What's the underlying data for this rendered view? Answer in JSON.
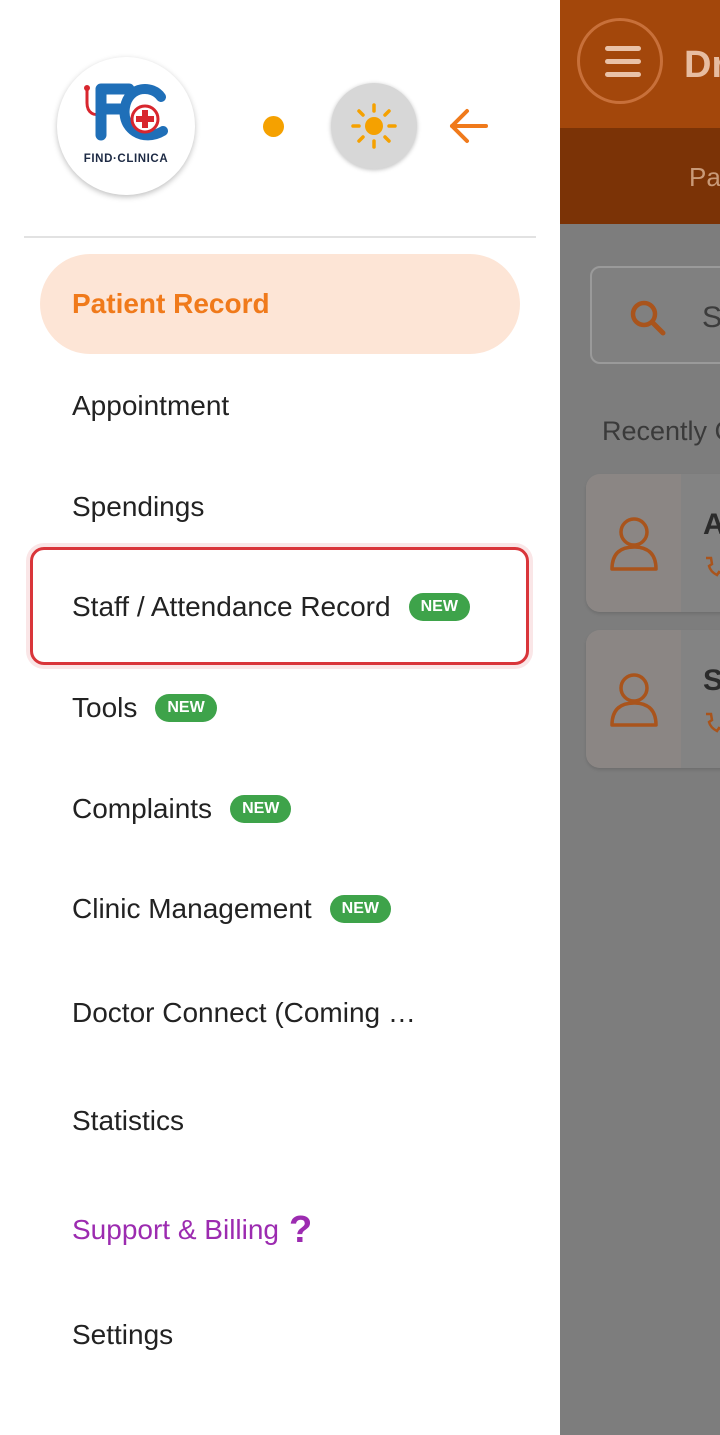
{
  "colors": {
    "accent": "#f07a1b",
    "active_bg": "#fde5d6",
    "badge_green": "#3ea34a",
    "support_purple": "#9c2bb0",
    "highlight_red": "#d9353a"
  },
  "logo": {
    "caption": "FIND·CLINICA",
    "icon": "find-clinica-logo"
  },
  "header_controls": {
    "status_dot_icon": "status-dot",
    "theme_toggle_icon": "sun-icon",
    "back_icon": "arrow-left-icon"
  },
  "menu": [
    {
      "label": "Patient Record",
      "active": true
    },
    {
      "label": "Appointment"
    },
    {
      "label": "Spendings"
    },
    {
      "label": "Staff / Attendance Record",
      "badge": "NEW",
      "highlighted": true
    },
    {
      "label": "Tools",
      "badge": "NEW"
    },
    {
      "label": "Complaints",
      "badge": "NEW"
    },
    {
      "label": "Clinic Management",
      "badge": "NEW"
    },
    {
      "label": "Doctor Connect (Coming …"
    },
    {
      "label": "Statistics"
    },
    {
      "label": "Support & Billing",
      "suffix": "?"
    },
    {
      "label": "Settings"
    }
  ],
  "background": {
    "header_title": "Dr",
    "tab_label": "Pa",
    "search_placeholder": "S",
    "recent_label": "Recently C",
    "cards": [
      {
        "initial": "A"
      },
      {
        "initial": "S"
      }
    ]
  }
}
